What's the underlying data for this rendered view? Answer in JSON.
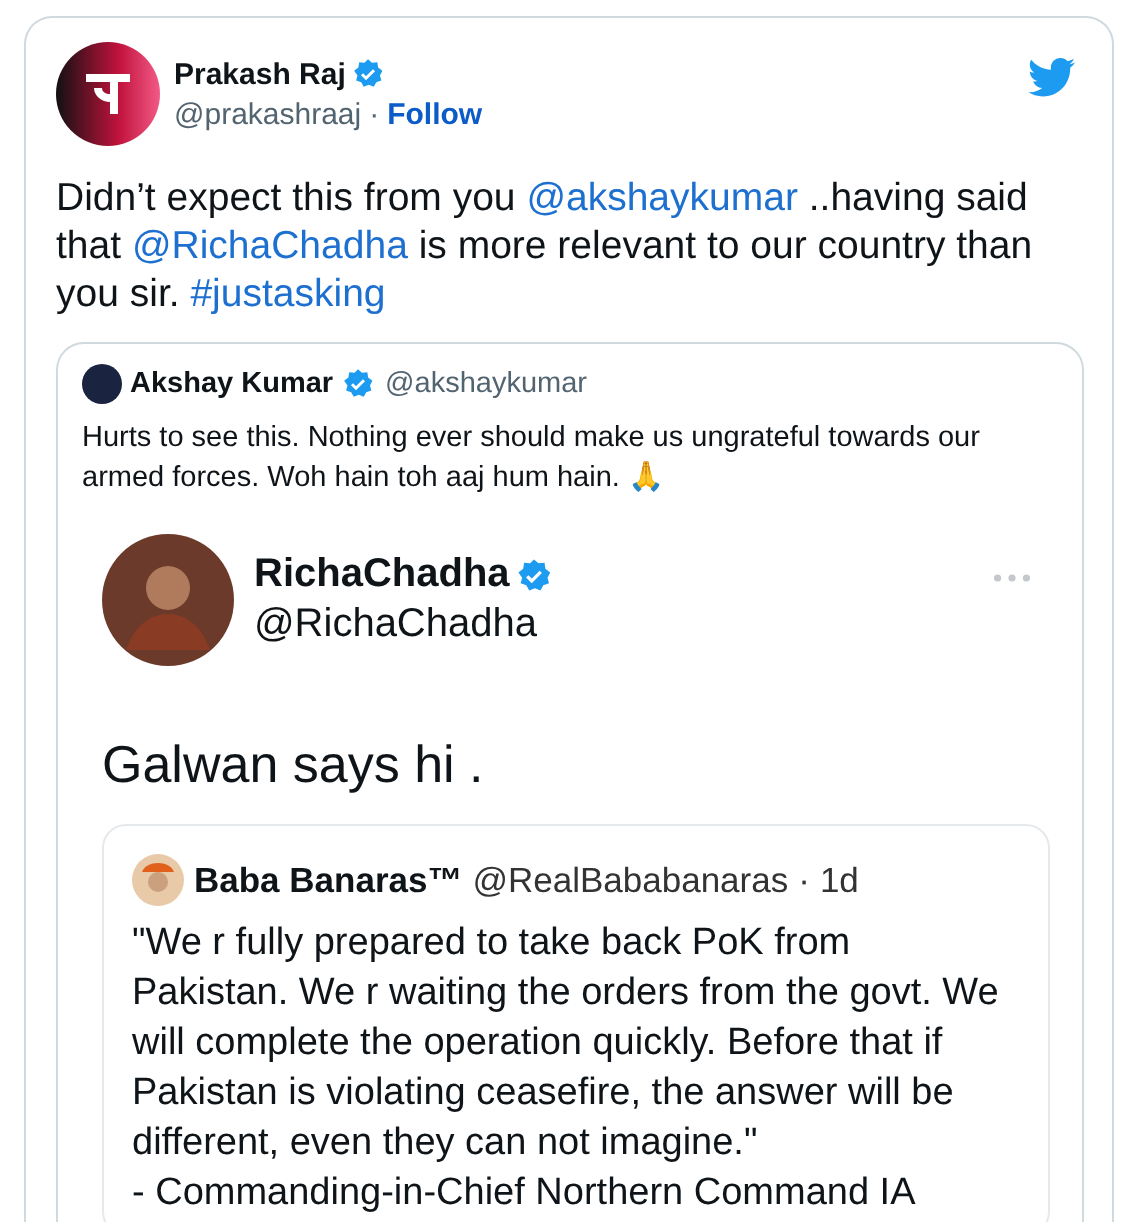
{
  "tweet": {
    "author": {
      "name": "Prakash Raj",
      "verified": true,
      "handle": "@prakashraaj",
      "separator": "·",
      "follow": "Follow"
    },
    "text": [
      {
        "kind": "plain",
        "text": "Didn’t expect this from you "
      },
      {
        "kind": "link",
        "text": "@akshaykumar"
      },
      {
        "kind": "plain",
        "text": " ..having said that "
      },
      {
        "kind": "link",
        "text": "@RichaChadha"
      },
      {
        "kind": "plain",
        "text": " is more relevant to our country than you sir. "
      },
      {
        "kind": "link",
        "text": "#justasking"
      }
    ],
    "quote": {
      "author": {
        "name": "Akshay Kumar",
        "verified": true,
        "handle": "@akshaykumar"
      },
      "text": "Hurts to see this. Nothing ever should make us ungrateful towards our armed forces. Woh hain toh aaj hum hain. 🙏",
      "image": {
        "kind": "screenshot",
        "author": {
          "name": "RichaChadha",
          "verified": true,
          "handle": "@RichaChadha"
        },
        "text": "Galwan says hi .",
        "quote": {
          "author": {
            "name": "Baba Banaras™",
            "handle": "@RealBababanaras",
            "separator": "·",
            "time": "1d"
          },
          "text": "\"We r fully prepared to take back PoK from Pakistan. We r waiting the orders from the govt. We will complete the operation quickly. Before that if Pakistan is violating ceasefire, the answer will be different, even they can not imagine.\"\n- Commanding-in-Chief Northern Command IA"
        }
      }
    }
  }
}
